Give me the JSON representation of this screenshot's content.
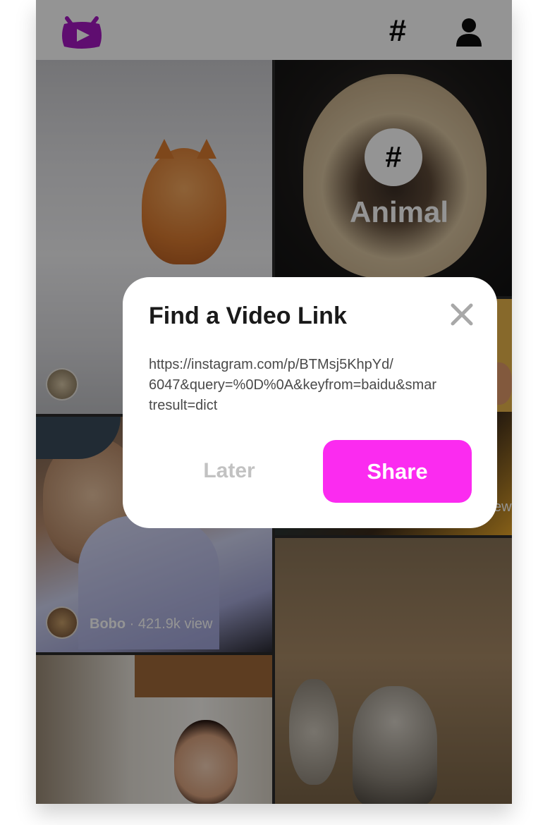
{
  "header": {
    "logo_icon": "purple-tv-play-icon",
    "hashtag_icon": "#",
    "profile_icon": "user-icon"
  },
  "feed": {
    "tiles": [
      {
        "type": "video",
        "avatar_icon": "avatar",
        "user": "",
        "views": ""
      },
      {
        "type": "category",
        "icon": "#",
        "label": "Animal"
      },
      {
        "type": "video",
        "views_suffix": "ew"
      },
      {
        "type": "video",
        "user": "Bobo",
        "views": "· 421.9k view"
      },
      {
        "type": "video"
      },
      {
        "type": "video"
      }
    ]
  },
  "dialog": {
    "title": "Find a Video Link",
    "close_icon": "close-icon",
    "link": "https://instagram.com/p/BTMsj5KhpYd/6047&query=%0D%0A&keyfrom=baidu&smartresult=dict",
    "link_lines": [
      "https://instagram.com/p/BTMsj5KhpYd/",
      "6047&query=%0D%0A&keyfrom=baidu&smar",
      "tresult=dict"
    ],
    "later_label": "Later",
    "share_label": "Share"
  },
  "colors": {
    "accent": "#fb2bf0",
    "logo": "#a417c2",
    "header_bg": "#ffffff",
    "overlay": "rgba(0,0,0,0.42)"
  }
}
